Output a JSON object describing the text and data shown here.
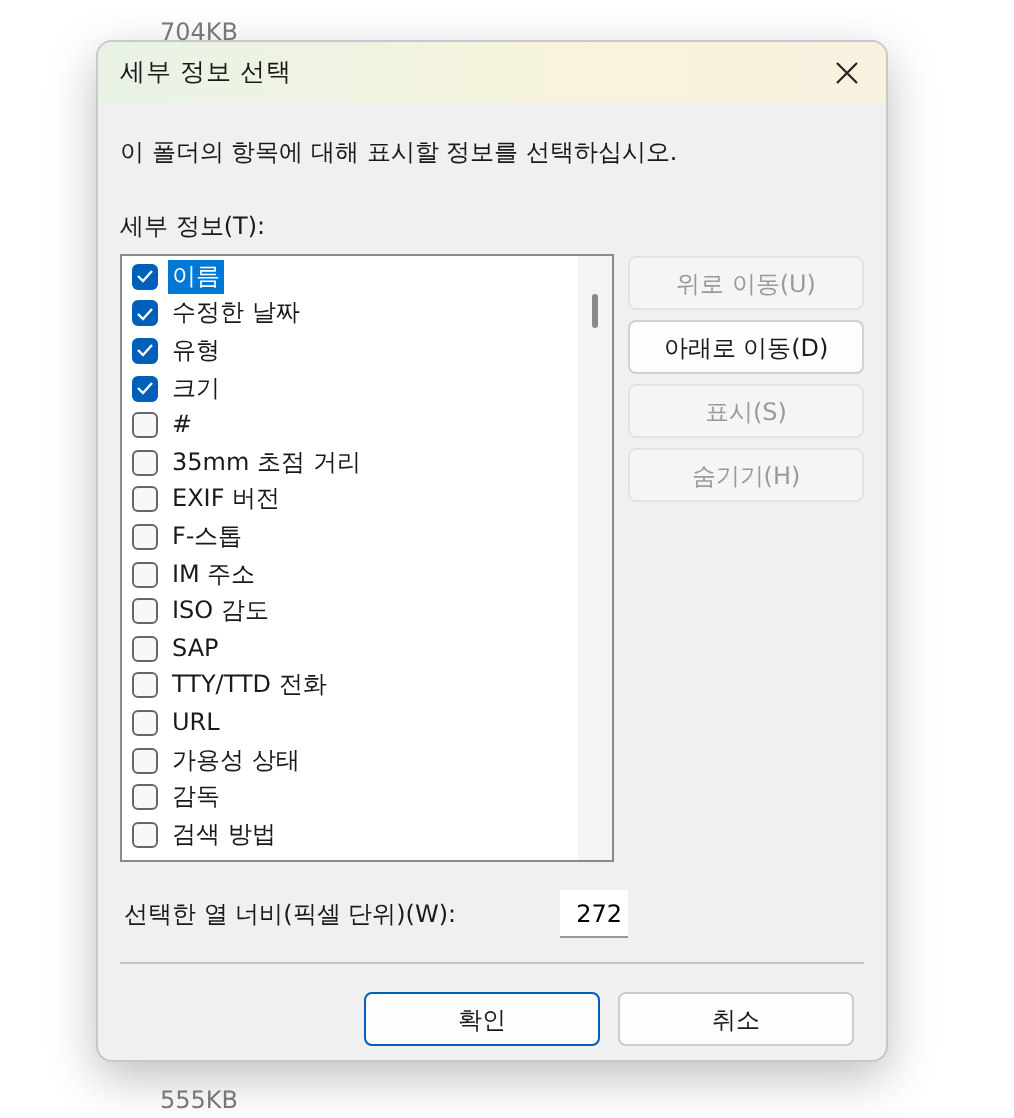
{
  "background": {
    "file_sizes": [
      "704KB",
      "555KB"
    ]
  },
  "window": {
    "title": "세부 정보 선택"
  },
  "instruction": "이 폴더의 항목에 대해 표시할 정보를 선택하십시오.",
  "details_label": "세부 정보(T):",
  "items": [
    {
      "label": "이름",
      "checked": true,
      "selected": true
    },
    {
      "label": "수정한 날짜",
      "checked": true,
      "selected": false
    },
    {
      "label": "유형",
      "checked": true,
      "selected": false
    },
    {
      "label": "크기",
      "checked": true,
      "selected": false
    },
    {
      "label": "#",
      "checked": false,
      "selected": false
    },
    {
      "label": "35mm 초점 거리",
      "checked": false,
      "selected": false
    },
    {
      "label": "EXIF 버전",
      "checked": false,
      "selected": false
    },
    {
      "label": "F-스톱",
      "checked": false,
      "selected": false
    },
    {
      "label": "IM 주소",
      "checked": false,
      "selected": false
    },
    {
      "label": "ISO 감도",
      "checked": false,
      "selected": false
    },
    {
      "label": "SAP",
      "checked": false,
      "selected": false
    },
    {
      "label": "TTY/TTD 전화",
      "checked": false,
      "selected": false
    },
    {
      "label": "URL",
      "checked": false,
      "selected": false
    },
    {
      "label": "가용성 상태",
      "checked": false,
      "selected": false
    },
    {
      "label": "감독",
      "checked": false,
      "selected": false
    },
    {
      "label": "검색 방법",
      "checked": false,
      "selected": false
    }
  ],
  "side_buttons": [
    {
      "label": "위로 이동(U)",
      "disabled": true
    },
    {
      "label": "아래로 이동(D)",
      "disabled": false
    },
    {
      "label": "표시(S)",
      "disabled": true
    },
    {
      "label": "숨기기(H)",
      "disabled": true
    }
  ],
  "width_label": "선택한 열 너비(픽셀 단위)(W):",
  "width_value": "272",
  "buttons": [
    {
      "label": "확인",
      "default": true
    },
    {
      "label": "취소",
      "default": false
    }
  ]
}
